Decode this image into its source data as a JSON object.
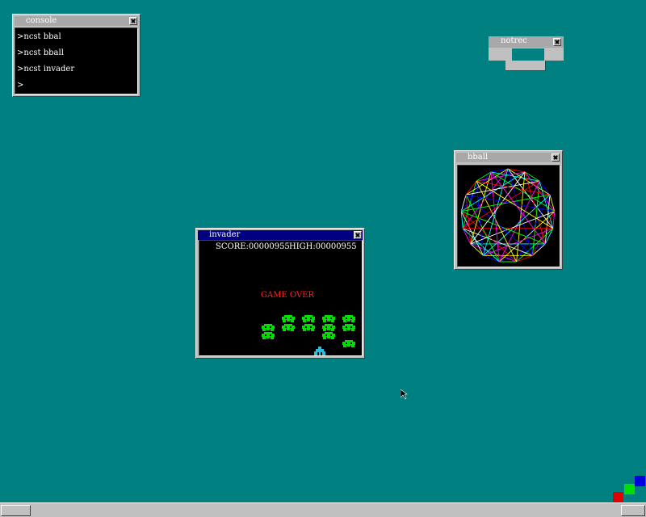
{
  "desktop": {
    "background": "#008080"
  },
  "console": {
    "title": "console",
    "lines": [
      ">ncst bbal",
      ">ncst bball",
      ">ncst invader",
      ">"
    ]
  },
  "notrec": {
    "title": "notrec"
  },
  "bball": {
    "title": "bball"
  },
  "invader": {
    "title": "invader",
    "score_text": "SCORE:00000955",
    "high_text": "HIGH:00000955",
    "game_over_text": "GAME OVER",
    "alien_color": "#00e000",
    "player_color": "#20c0e0"
  },
  "taskbar": {
    "squares": [
      "#e00000",
      "#00e000",
      "#0000e0"
    ]
  },
  "icons": [
    "close-icon",
    "mouse-cursor-icon",
    "alien-icon",
    "player-cannon-icon"
  ]
}
